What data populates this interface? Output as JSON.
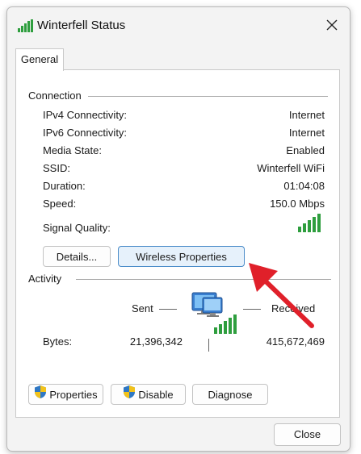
{
  "window": {
    "title": "Winterfell Status",
    "icon": "wifi-signal-icon",
    "close_icon": "close-icon"
  },
  "tabs": [
    {
      "label": "General",
      "selected": true
    }
  ],
  "connection": {
    "group_label": "Connection",
    "rows": [
      {
        "label": "IPv4 Connectivity:",
        "value": "Internet"
      },
      {
        "label": "IPv6 Connectivity:",
        "value": "Internet"
      },
      {
        "label": "Media State:",
        "value": "Enabled"
      },
      {
        "label": "SSID:",
        "value": "Winterfell WiFi"
      },
      {
        "label": "Duration:",
        "value": "01:04:08"
      },
      {
        "label": "Speed:",
        "value": "150.0 Mbps"
      }
    ],
    "signal_quality_label": "Signal Quality:",
    "signal_bars": 5,
    "signal_color": "#2e9e3e",
    "details_button": "Details...",
    "wireless_properties_button": "Wireless Properties"
  },
  "activity": {
    "group_label": "Activity",
    "sent_label": "Sent",
    "received_label": "Received",
    "bytes_label": "Bytes:",
    "bytes_sent": "21,396,342",
    "bytes_received": "415,672,469"
  },
  "buttons": {
    "properties": "Properties",
    "disable": "Disable",
    "diagnose": "Diagnose",
    "close": "Close"
  },
  "colors": {
    "accent": "#4a8cc9",
    "annotation_arrow": "#e0202a"
  }
}
